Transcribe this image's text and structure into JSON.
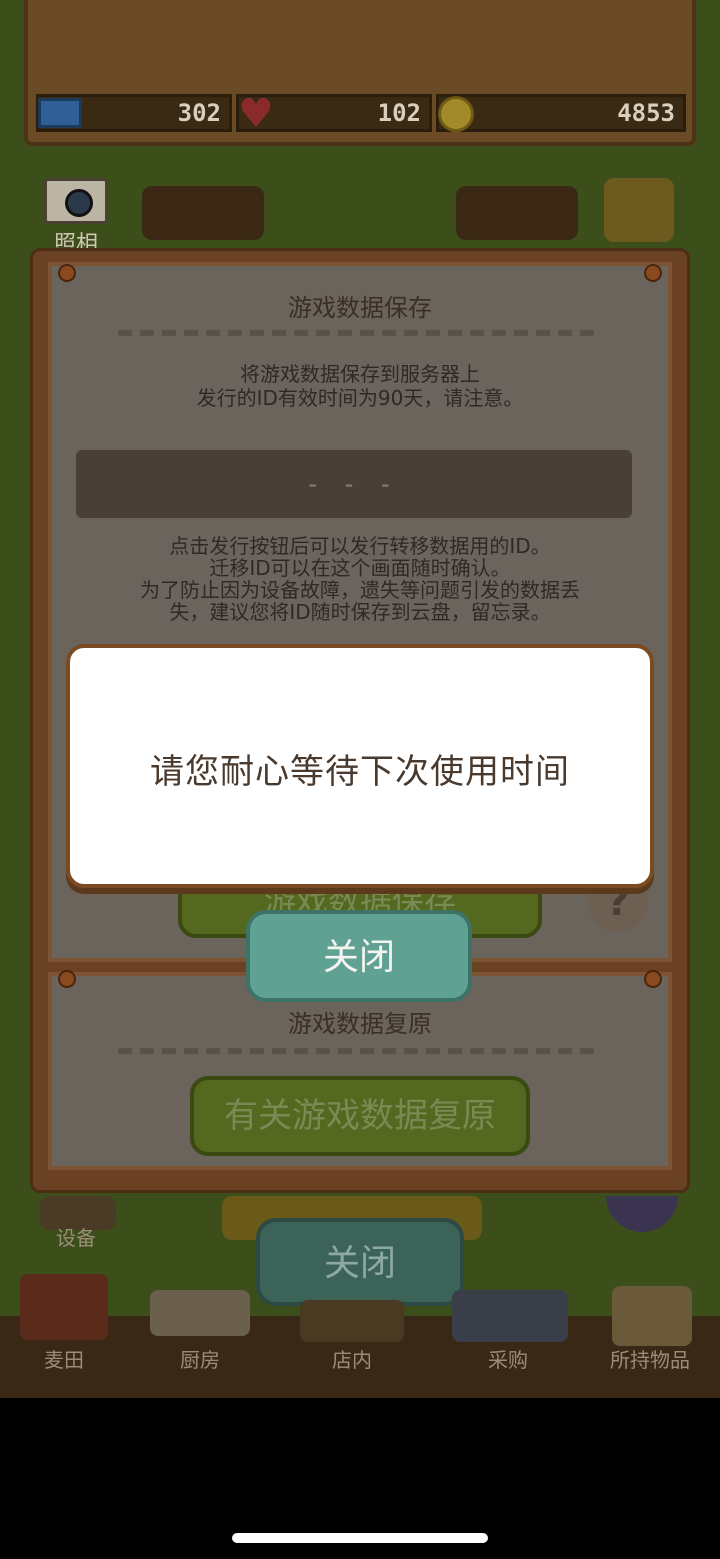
{
  "resources": {
    "tickets": "302",
    "hearts": "102",
    "coins": "4853"
  },
  "camera": {
    "label": "照相"
  },
  "save_section": {
    "title": "游戏数据保存",
    "description_line1": "将游戏数据保存到服务器上",
    "description_line2": "发行的ID有效时间为90天，请注意。",
    "id_placeholder": "- - -",
    "note_line1": "点击发行按钮后可以发行转移数据用的ID。",
    "note_line2": "迁移ID可以在这个画面随时确认。",
    "note_line3": "为了防止因为设备故障，遗失等问题引发的数据丢",
    "note_line4": "失，建议您将ID随时保存到云盘，留忘录。",
    "save_button_label": "游戏数据保存",
    "help_icon": "?"
  },
  "dialog": {
    "message": "请您耐心等待下次使用时间",
    "close_label": "关闭"
  },
  "restore_section": {
    "title": "游戏数据复原",
    "restore_button_label": "有关游戏数据复原"
  },
  "panel_close_label": "关闭",
  "equipment_label": "设备",
  "bottom_nav": [
    {
      "label": "麦田",
      "icon": "wheat-field-icon"
    },
    {
      "label": "厨房",
      "icon": "kitchen-icon"
    },
    {
      "label": "店内",
      "icon": "store-icon"
    },
    {
      "label": "采购",
      "icon": "purchase-icon"
    },
    {
      "label": "所持物品",
      "icon": "inventory-box-icon"
    }
  ]
}
